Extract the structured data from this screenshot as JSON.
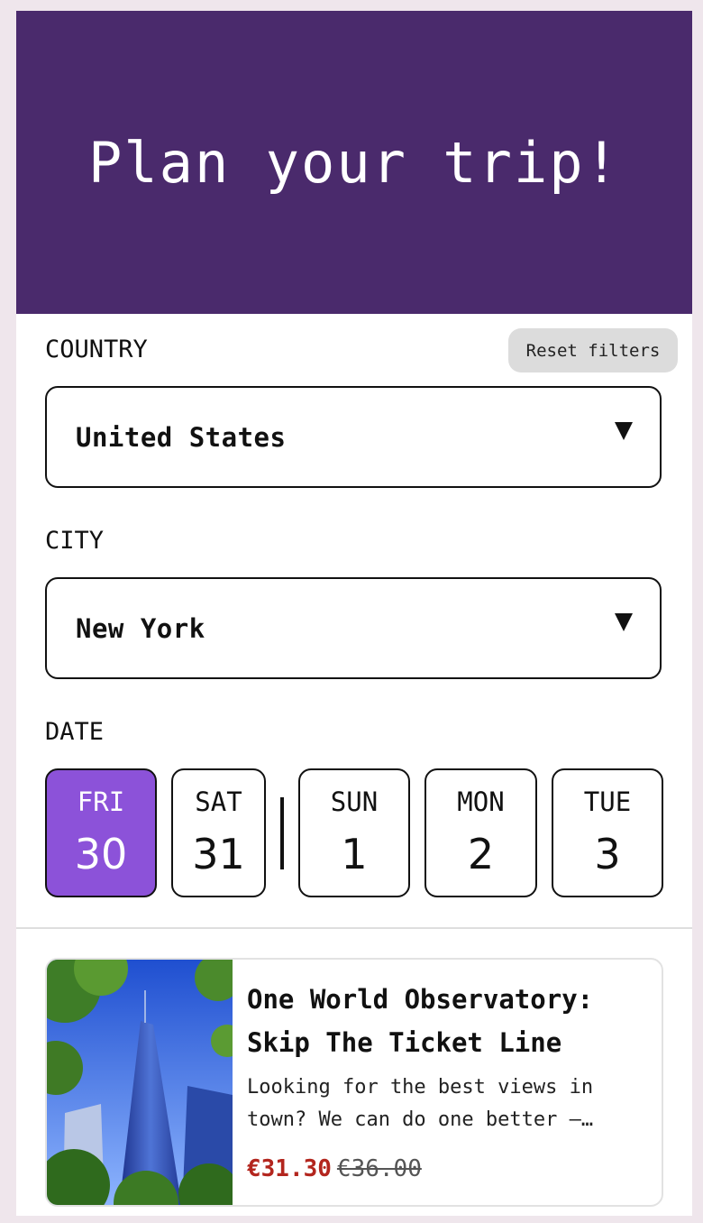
{
  "header": {
    "title": "Plan your trip!",
    "color": "#4a2a6c"
  },
  "filters": {
    "reset_label": "Reset filters",
    "country": {
      "label": "COUNTRY",
      "value": "United States"
    },
    "city": {
      "label": "CITY",
      "value": "New York"
    },
    "date": {
      "label": "DATE",
      "days": [
        {
          "dow": "FRI",
          "num": "30",
          "selected": true
        },
        {
          "dow": "SAT",
          "num": "31",
          "selected": false
        },
        {
          "dow": "SUN",
          "num": "1",
          "selected": false
        },
        {
          "dow": "MON",
          "num": "2",
          "selected": false
        },
        {
          "dow": "TUE",
          "num": "3",
          "selected": false
        }
      ],
      "selected_color": "#8c52d9"
    }
  },
  "listing": {
    "title": "One World Observatory: Skip The Ticket Line",
    "description": "Looking for the best views in town? We can do one better —…",
    "price_now": "€31.30",
    "price_was": "€36.00",
    "price_color": "#b3261e"
  }
}
